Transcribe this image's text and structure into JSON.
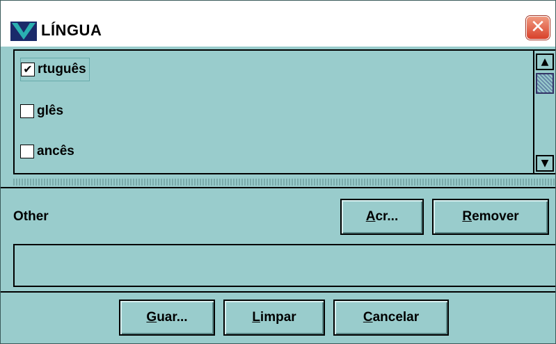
{
  "window": {
    "title": "LÍNGUA",
    "close_glyph": "✕",
    "icon": "app-logo-icon"
  },
  "languages": [
    {
      "label": "rtuguês",
      "checked": true,
      "selected": true
    },
    {
      "label": "glês",
      "checked": false,
      "selected": false
    },
    {
      "label": "ancês",
      "checked": false,
      "selected": false
    }
  ],
  "scrollbar": {
    "up_glyph": "▲",
    "down_glyph": "▼"
  },
  "other": {
    "label": "Other",
    "add_button": {
      "mnemonic": "A",
      "rest": "cr..."
    },
    "remove_button": {
      "mnemonic": "R",
      "rest": "emover"
    },
    "text_value": ""
  },
  "footer": {
    "save_button": {
      "mnemonic": "G",
      "rest": "uar..."
    },
    "clear_button": {
      "mnemonic": "L",
      "rest": "impar"
    },
    "cancel_button": {
      "mnemonic": "C",
      "rest": "ancelar"
    }
  },
  "colors": {
    "panel": "#99cccc",
    "close": "#d8402a",
    "check": "#000000"
  }
}
